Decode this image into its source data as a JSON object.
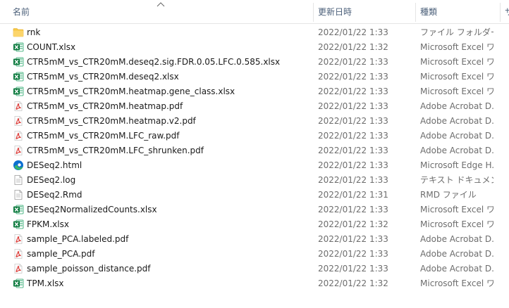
{
  "columns": {
    "name": "名前",
    "date": "更新日時",
    "type": "種類",
    "extra": "サ"
  },
  "files": [
    {
      "icon": "folder-icon",
      "name": "rnk",
      "date": "2022/01/22 1:33",
      "type": "ファイル フォルダー"
    },
    {
      "icon": "excel-icon",
      "name": "COUNT.xlsx",
      "date": "2022/01/22 1:32",
      "type": "Microsoft Excel ワ"
    },
    {
      "icon": "excel-icon",
      "name": "CTR5mM_vs_CTR20mM.deseq2.sig.FDR.0.05.LFC.0.585.xlsx",
      "date": "2022/01/22 1:33",
      "type": "Microsoft Excel ワ"
    },
    {
      "icon": "excel-icon",
      "name": "CTR5mM_vs_CTR20mM.deseq2.xlsx",
      "date": "2022/01/22 1:33",
      "type": "Microsoft Excel ワ"
    },
    {
      "icon": "excel-icon",
      "name": "CTR5mM_vs_CTR20mM.heatmap.gene_class.xlsx",
      "date": "2022/01/22 1:33",
      "type": "Microsoft Excel ワ"
    },
    {
      "icon": "pdf-icon",
      "name": "CTR5mM_vs_CTR20mM.heatmap.pdf",
      "date": "2022/01/22 1:33",
      "type": "Adobe Acrobat D..."
    },
    {
      "icon": "pdf-icon",
      "name": "CTR5mM_vs_CTR20mM.heatmap.v2.pdf",
      "date": "2022/01/22 1:33",
      "type": "Adobe Acrobat D..."
    },
    {
      "icon": "pdf-icon",
      "name": "CTR5mM_vs_CTR20mM.LFC_raw.pdf",
      "date": "2022/01/22 1:33",
      "type": "Adobe Acrobat D..."
    },
    {
      "icon": "pdf-icon",
      "name": "CTR5mM_vs_CTR20mM.LFC_shrunken.pdf",
      "date": "2022/01/22 1:33",
      "type": "Adobe Acrobat D..."
    },
    {
      "icon": "edge-icon",
      "name": "DESeq2.html",
      "date": "2022/01/22 1:33",
      "type": "Microsoft Edge H..."
    },
    {
      "icon": "text-file-icon",
      "name": "DESeq2.log",
      "date": "2022/01/22 1:33",
      "type": "テキスト ドキュメント"
    },
    {
      "icon": "text-file-icon",
      "name": "DESeq2.Rmd",
      "date": "2022/01/22 1:31",
      "type": "RMD ファイル"
    },
    {
      "icon": "excel-icon",
      "name": "DESeq2NormalizedCounts.xlsx",
      "date": "2022/01/22 1:33",
      "type": "Microsoft Excel ワ"
    },
    {
      "icon": "excel-icon",
      "name": "FPKM.xlsx",
      "date": "2022/01/22 1:32",
      "type": "Microsoft Excel ワ"
    },
    {
      "icon": "pdf-icon",
      "name": "sample_PCA.labeled.pdf",
      "date": "2022/01/22 1:33",
      "type": "Adobe Acrobat D..."
    },
    {
      "icon": "pdf-icon",
      "name": "sample_PCA.pdf",
      "date": "2022/01/22 1:33",
      "type": "Adobe Acrobat D..."
    },
    {
      "icon": "pdf-icon",
      "name": "sample_poisson_distance.pdf",
      "date": "2022/01/22 1:33",
      "type": "Adobe Acrobat D..."
    },
    {
      "icon": "excel-icon",
      "name": "TPM.xlsx",
      "date": "2022/01/22 1:32",
      "type": "Microsoft Excel ワ"
    }
  ],
  "colors": {
    "header_text": "#4c607a",
    "meta_text": "#6d6d6d",
    "excel": "#107c41",
    "pdf": "#d9302c",
    "folder": "#f8c843",
    "edge_blue": "#0c6fd1",
    "edge_green": "#36b56a"
  }
}
